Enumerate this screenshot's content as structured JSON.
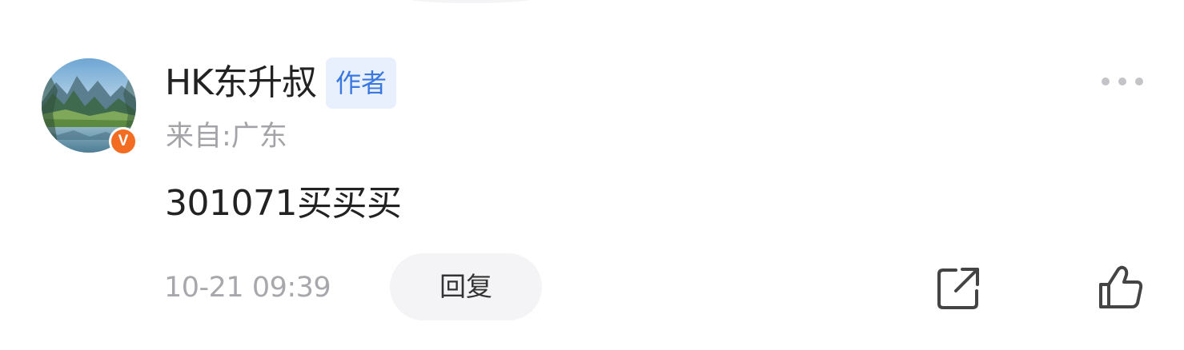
{
  "comment": {
    "username": "HK东升叔",
    "author_tag": "作者",
    "verified_badge": "V",
    "location": "来自:广东",
    "content": "301071买买买",
    "timestamp": "10-21 09:39",
    "reply_label": "回复"
  },
  "icons": {
    "more": "more-dots-icon",
    "share": "share-icon",
    "like": "thumbs-up-icon"
  },
  "colors": {
    "author_tag_bg": "#e8f0fd",
    "author_tag_text": "#3a78e0",
    "verified_badge": "#f26d21",
    "secondary_text": "#a4a4a8"
  }
}
